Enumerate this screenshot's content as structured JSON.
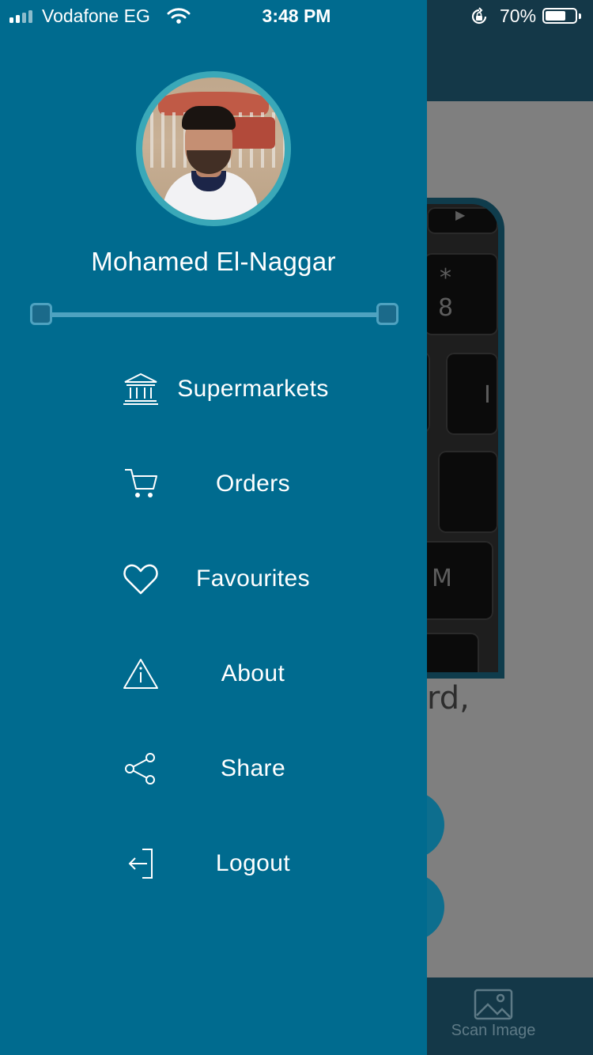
{
  "status_bar": {
    "carrier": "Vodafone EG",
    "time": "3:48 PM",
    "battery_percent_text": "70%",
    "battery_level": 0.7,
    "signal_bars": 4,
    "icons": [
      "signal-icon",
      "wifi-icon",
      "rotation-lock-icon",
      "battery-icon"
    ]
  },
  "drawer": {
    "avatar_icon": "user-avatar",
    "user_name": "Mohamed El-Naggar",
    "range_slider": {
      "min_value": 0,
      "max_value": 1
    },
    "menu": [
      {
        "label": "Supermarkets",
        "icon": "bank-icon"
      },
      {
        "label": "Orders",
        "icon": "cart-icon"
      },
      {
        "label": "Favourites",
        "icon": "heart-icon"
      },
      {
        "label": "About",
        "icon": "warning-icon"
      },
      {
        "label": "Share",
        "icon": "share-icon"
      },
      {
        "label": "Logout",
        "icon": "logout-icon"
      }
    ]
  },
  "background": {
    "partial_text": "rd,",
    "key_labels": [
      "*",
      "8",
      "I",
      "M"
    ],
    "tab_bar": {
      "scan_label": "Scan Image",
      "scan_icon": "image-icon"
    }
  },
  "colors": {
    "drawer": "#006b8f",
    "header": "#143848",
    "overlay": "#7f7f7f",
    "accent": "#3aa8b8"
  }
}
